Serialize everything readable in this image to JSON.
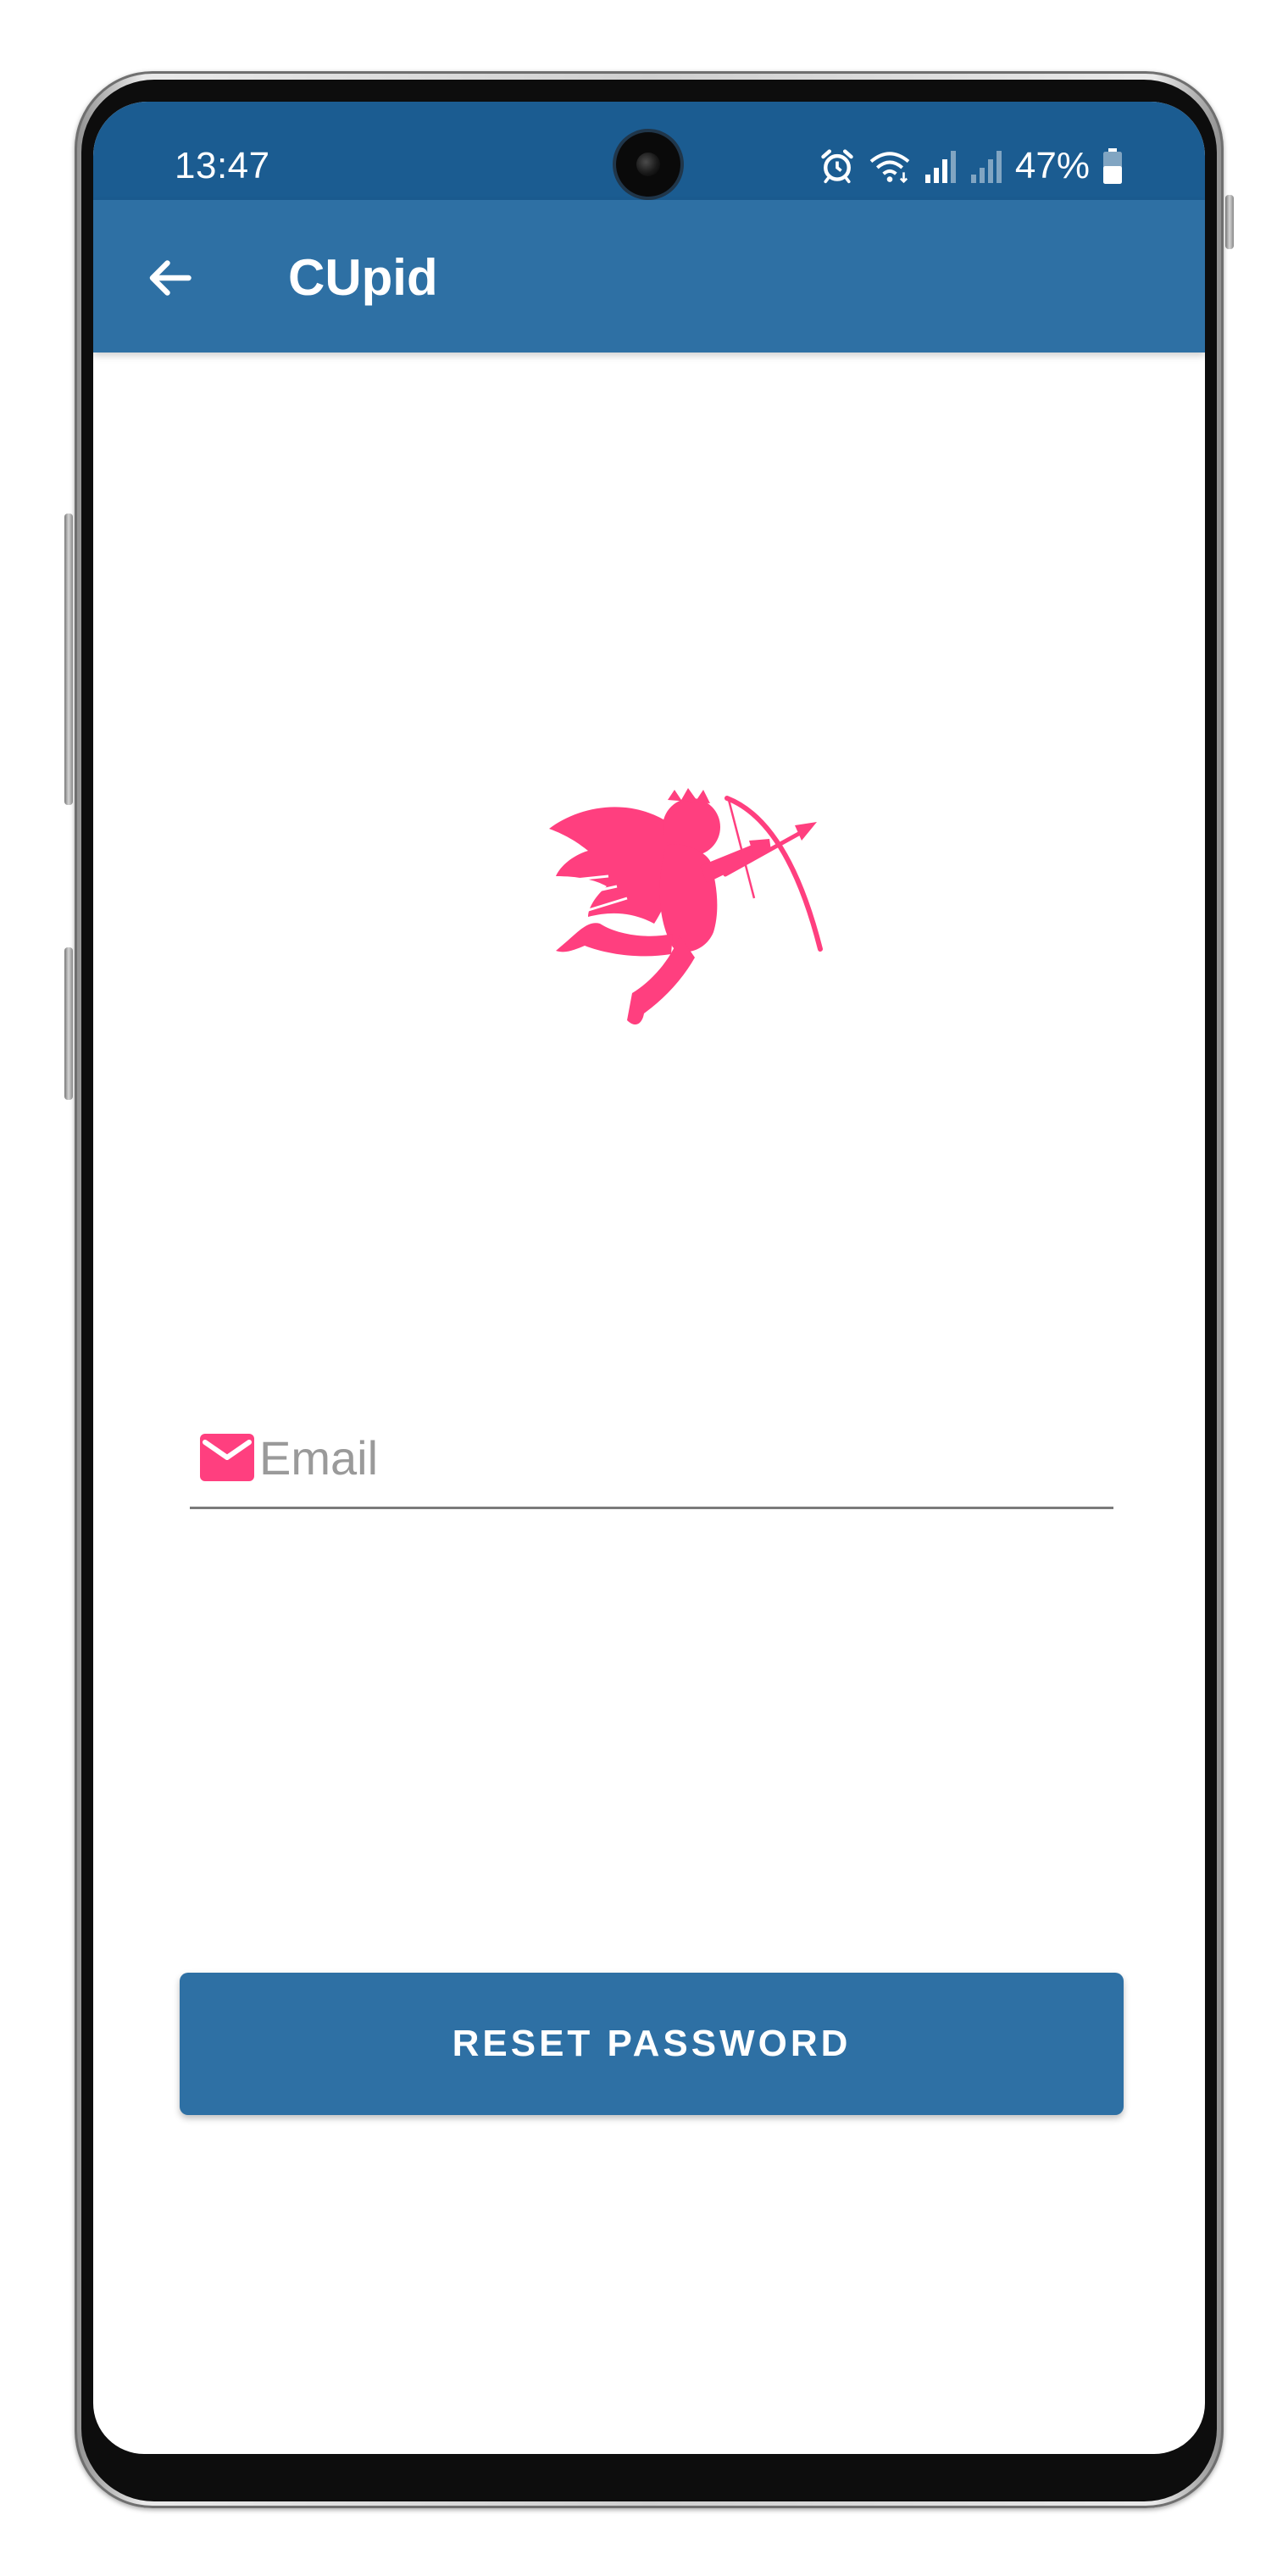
{
  "status_bar": {
    "time": "13:47",
    "battery_text": "47%",
    "icons": [
      "alarm-icon",
      "wifi-icon",
      "signal-icon",
      "signal-icon",
      "battery-icon"
    ],
    "background_color": "#1b5c91"
  },
  "app_bar": {
    "title": "CUpid",
    "back_icon": "arrow-left-icon",
    "background_color": "#2e70a4"
  },
  "logo": {
    "icon": "cupid-logo",
    "color": "#ff3f7f"
  },
  "form": {
    "email": {
      "icon": "mail-icon",
      "placeholder": "Email",
      "value": ""
    },
    "reset_button_label": "RESET PASSWORD"
  },
  "colors": {
    "accent": "#ff3f7f",
    "primary": "#2e70a4"
  }
}
